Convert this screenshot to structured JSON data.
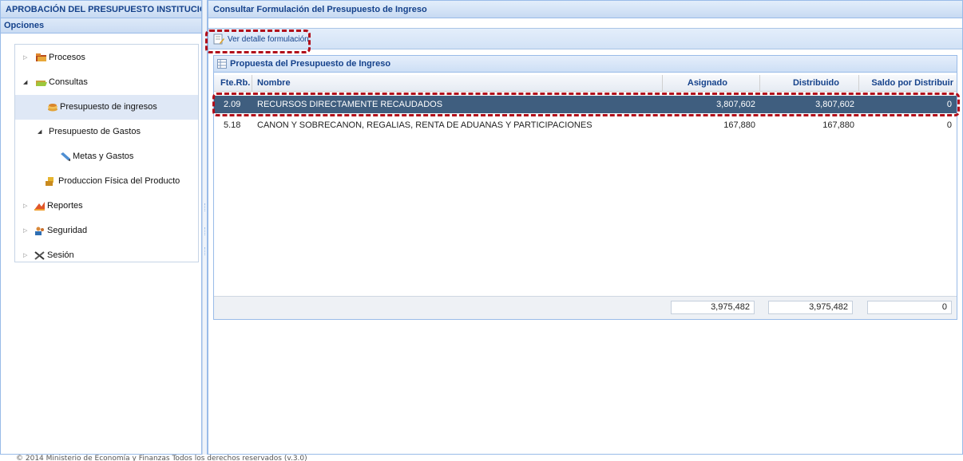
{
  "left_panel": {
    "title": "APROBACIÓN DEL PRESUPUESTO INSTITUCIONA",
    "options_header": "Opciones",
    "tree": [
      {
        "label": "Procesos",
        "icon": "folder-icon"
      },
      {
        "label": "Consultas",
        "icon": "folder-icon"
      },
      {
        "label": "Presupuesto de ingresos",
        "icon": "coins-icon"
      },
      {
        "label": "Presupuesto de Gastos"
      },
      {
        "label": "Metas y Gastos",
        "icon": "pencil-icon"
      },
      {
        "label": "Produccion Física del Producto",
        "icon": "box-icon"
      },
      {
        "label": "Reportes",
        "icon": "chart-icon"
      },
      {
        "label": "Seguridad",
        "icon": "users-icon"
      },
      {
        "label": "Sesión",
        "icon": "tools-icon"
      }
    ]
  },
  "right_panel": {
    "title": "Consultar Formulación del Presupuesto de Ingreso",
    "toolbar": {
      "ver_detalle": "Ver detalle formulación"
    },
    "grid": {
      "title": "Propuesta del Presupuesto de Ingreso",
      "columns": [
        "Fte.Rb.",
        "Nombre",
        "Asignado",
        "Distribuido",
        "Saldo por Distribuir"
      ],
      "rows": [
        {
          "fte": "2.09",
          "nombre": "RECURSOS DIRECTAMENTE RECAUDADOS",
          "asignado": "3,807,602",
          "distribuido": "3,807,602",
          "saldo": "0"
        },
        {
          "fte": "5.18",
          "nombre": "CANON Y SOBRECANON, REGALIAS, RENTA DE ADUANAS Y PARTICIPACIONES",
          "asignado": "167,880",
          "distribuido": "167,880",
          "saldo": "0"
        }
      ],
      "totals": {
        "asignado": "3,975,482",
        "distribuido": "3,975,482",
        "saldo": "0"
      }
    }
  },
  "footer": {
    "copyright": "© 2014 Ministerio de Economía y Finanzas Todos los derechos reservados (v.3.0)"
  },
  "colors": {
    "header_text": "#15428b",
    "selected_row": "#3f5e7f",
    "highlight": "#b10d1a",
    "border": "#99bbe8"
  }
}
